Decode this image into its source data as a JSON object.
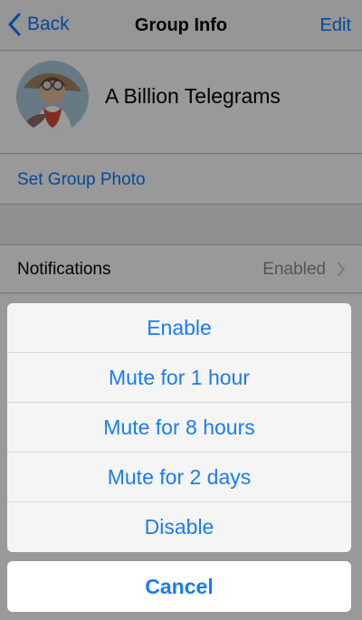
{
  "nav": {
    "back_label": "Back",
    "title": "Group Info",
    "edit_label": "Edit"
  },
  "group": {
    "name": "A Billion Telegrams",
    "set_photo_label": "Set Group Photo"
  },
  "notifications": {
    "label": "Notifications",
    "value": "Enabled"
  },
  "action_sheet": {
    "options": [
      "Enable",
      "Mute for 1 hour",
      "Mute for 8 hours",
      "Mute for 2 days",
      "Disable"
    ],
    "cancel_label": "Cancel"
  },
  "colors": {
    "accent": "#0a7aff"
  }
}
